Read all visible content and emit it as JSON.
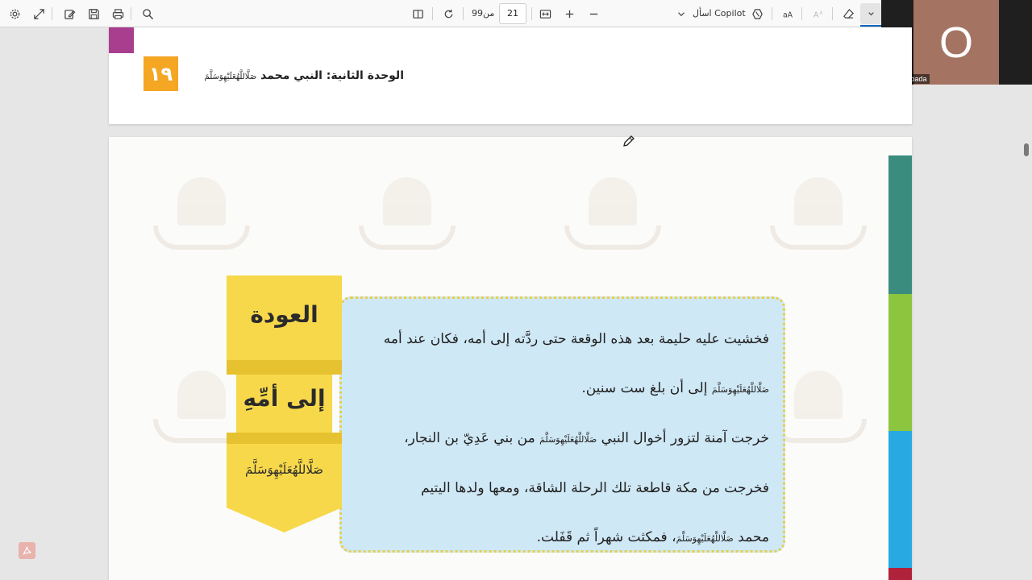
{
  "toolbar": {
    "page_current": "21",
    "page_of_label": "من",
    "page_total": "99",
    "copilot_label": "اسأل Copilot",
    "icons": [
      "settings-icon",
      "expand-icon",
      "draw-icon",
      "save-icon",
      "print-icon",
      "search-icon",
      "layout-icon",
      "rotate-icon",
      "fit-width-icon",
      "zoom-in-icon",
      "zoom-out-icon",
      "copilot-icon",
      "read-aloud-icon",
      "text-size-icon",
      "eraser-icon",
      "chevron-down-icon"
    ]
  },
  "video": {
    "initial": "O",
    "name": "Oday Albada",
    "avatar_color": "#a47362"
  },
  "page_top": {
    "unit_number": "١٩",
    "unit_title": "الوحدة الثانية: النبي محمد",
    "salawat": "صَلَّاللَّهُعَلَيْهِوَسَلَّمَ",
    "accent_color": "#a93e8e",
    "badge_color": "#f5a623"
  },
  "lesson": {
    "banner_title_1": "العودة",
    "banner_title_2": "إلى أمِّهِ",
    "banner_salawat": "صَلَّاللَّهُعَلَيْهِوَسَلَّمَ",
    "paragraph_1a": "فخشيت عليه حليمة بعد هذه الوقعة حتى ردَّته إلى أمه، فكان عند أمه",
    "paragraph_1b_sal": "صَلَّاللَّهُعَلَيْهِوَسَلَّمَ",
    "paragraph_1b": " إلى أن بلغ ست سنين.",
    "paragraph_2a_pre": "خرجت آمنة لتزور أخوال النبي ",
    "paragraph_2a_sal": "صَلَّاللَّهُعَلَيْهِوَسَلَّمَ",
    "paragraph_2a_post": " من بني عَدِيّ بن النجار،",
    "paragraph_2b": "فخرجت من مكة قاطعة تلك الرحلة الشاقة، ومعها ولدها اليتيم",
    "paragraph_2c_pre": "محمد ",
    "paragraph_2c_sal": "صَلَّاللَّهُعَلَيْهِوَسَلَّمَ",
    "paragraph_2c_post": "، فمكثت شهراً ثم قَفَلت.",
    "stripe_colors": [
      "#3a8c7e",
      "#8cc63f",
      "#29a9e1",
      "#b0223a"
    ]
  }
}
